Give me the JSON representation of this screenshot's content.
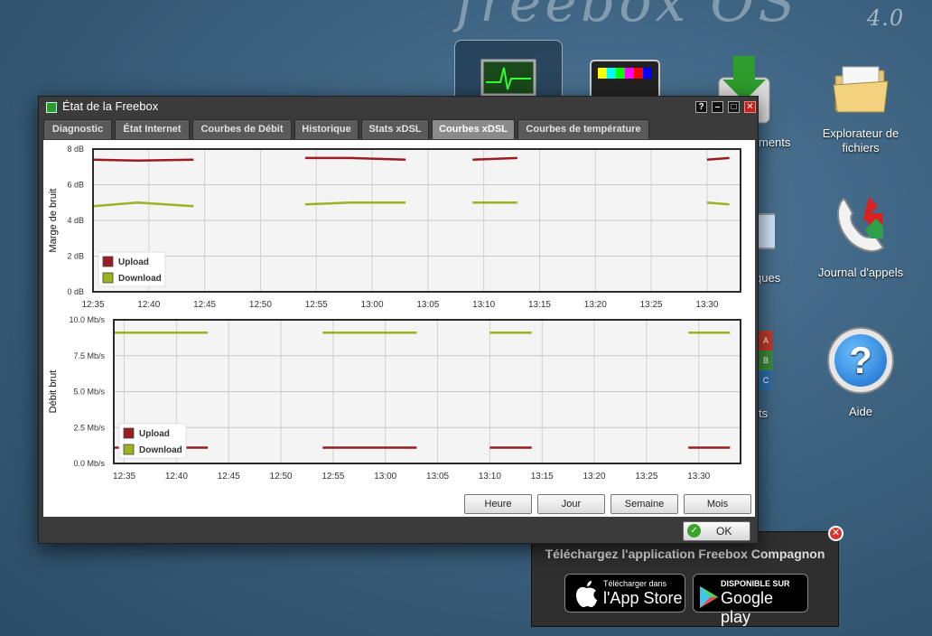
{
  "desktop": {
    "logo_text": "freebox OS",
    "version": "4.0",
    "icons": [
      {
        "label": "Explorateur de fichiers",
        "icon": "folder-icon"
      },
      {
        "label": "Journal d'appels",
        "icon": "phone-icon"
      },
      {
        "label": "Aide",
        "icon": "help-icon"
      }
    ],
    "partial_labels": [
      "ments",
      "ques",
      "ts"
    ]
  },
  "window": {
    "title": "État de la Freebox",
    "controls": {
      "help": "?",
      "minimize": "–",
      "maximize": "□",
      "close": "✕"
    },
    "tabs": [
      {
        "label": "Diagnostic",
        "active": false
      },
      {
        "label": "État Internet",
        "active": false
      },
      {
        "label": "Courbes de Débit",
        "active": false
      },
      {
        "label": "Historique",
        "active": false
      },
      {
        "label": "Stats xDSL",
        "active": false
      },
      {
        "label": "Courbes xDSL",
        "active": true
      },
      {
        "label": "Courbes de température",
        "active": false
      }
    ],
    "range_buttons": [
      "Heure",
      "Jour",
      "Semaine",
      "Mois"
    ],
    "ok_label": "OK"
  },
  "colors": {
    "upload": "#9b1b22",
    "download": "#9bb321"
  },
  "chart_data": [
    {
      "type": "line",
      "title": "",
      "ylabel": "Marge de bruit",
      "xlabel": "",
      "ylim": [
        0,
        8
      ],
      "yticks": [
        "0 dB",
        "2 dB",
        "4 dB",
        "6 dB",
        "8 dB"
      ],
      "xticks": [
        "12:35",
        "12:40",
        "12:45",
        "12:50",
        "12:55",
        "13:00",
        "13:05",
        "13:10",
        "13:15",
        "13:20",
        "13:25",
        "13:30"
      ],
      "grid": true,
      "legend": "bottom-left",
      "series": [
        {
          "name": "Upload",
          "segments": [
            {
              "x": [
                "12:35",
                "12:39",
                "12:44"
              ],
              "y": [
                7.4,
                7.35,
                7.4
              ]
            },
            {
              "x": [
                "12:54",
                "12:58",
                "13:03"
              ],
              "y": [
                7.5,
                7.5,
                7.4
              ]
            },
            {
              "x": [
                "13:09",
                "13:13"
              ],
              "y": [
                7.4,
                7.5
              ]
            },
            {
              "x": [
                "13:30",
                "13:32"
              ],
              "y": [
                7.4,
                7.5
              ]
            }
          ]
        },
        {
          "name": "Download",
          "segments": [
            {
              "x": [
                "12:35",
                "12:39",
                "12:44"
              ],
              "y": [
                4.8,
                5.0,
                4.8
              ]
            },
            {
              "x": [
                "12:54",
                "12:58",
                "13:03"
              ],
              "y": [
                4.9,
                5.0,
                5.0
              ]
            },
            {
              "x": [
                "13:09",
                "13:13"
              ],
              "y": [
                5.0,
                5.0
              ]
            },
            {
              "x": [
                "13:30",
                "13:32"
              ],
              "y": [
                5.0,
                4.9
              ]
            }
          ]
        }
      ]
    },
    {
      "type": "line",
      "title": "",
      "ylabel": "Débit brut",
      "xlabel": "",
      "ylim": [
        0,
        10
      ],
      "yticks": [
        "0.0 Mb/s",
        "2.5 Mb/s",
        "5.0 Mb/s",
        "7.5 Mb/s",
        "10.0 Mb/s"
      ],
      "xticks": [
        "12:35",
        "12:40",
        "12:45",
        "12:50",
        "12:55",
        "13:00",
        "13:05",
        "13:10",
        "13:15",
        "13:20",
        "13:25",
        "13:30"
      ],
      "grid": true,
      "legend": "bottom-left",
      "series": [
        {
          "name": "Upload",
          "segments": [
            {
              "x": [
                "12:34",
                "12:43"
              ],
              "y": [
                1.1,
                1.1
              ]
            },
            {
              "x": [
                "12:54",
                "13:03"
              ],
              "y": [
                1.1,
                1.1
              ]
            },
            {
              "x": [
                "13:10",
                "13:14"
              ],
              "y": [
                1.1,
                1.1
              ]
            },
            {
              "x": [
                "13:29",
                "13:33"
              ],
              "y": [
                1.1,
                1.1
              ]
            }
          ]
        },
        {
          "name": "Download",
          "segments": [
            {
              "x": [
                "12:34",
                "12:43"
              ],
              "y": [
                9.1,
                9.1
              ]
            },
            {
              "x": [
                "12:54",
                "13:03"
              ],
              "y": [
                9.1,
                9.1
              ]
            },
            {
              "x": [
                "13:10",
                "13:14"
              ],
              "y": [
                9.1,
                9.1
              ]
            },
            {
              "x": [
                "13:29",
                "13:33"
              ],
              "y": [
                9.1,
                9.1
              ]
            }
          ]
        }
      ]
    }
  ],
  "companion": {
    "title": "Téléchargez l'application Freebox Compagnon",
    "appstore_small": "Télécharger dans",
    "appstore_big": "l'App Store",
    "googleplay_small": "DISPONIBLE SUR",
    "googleplay_big": "Google play"
  }
}
